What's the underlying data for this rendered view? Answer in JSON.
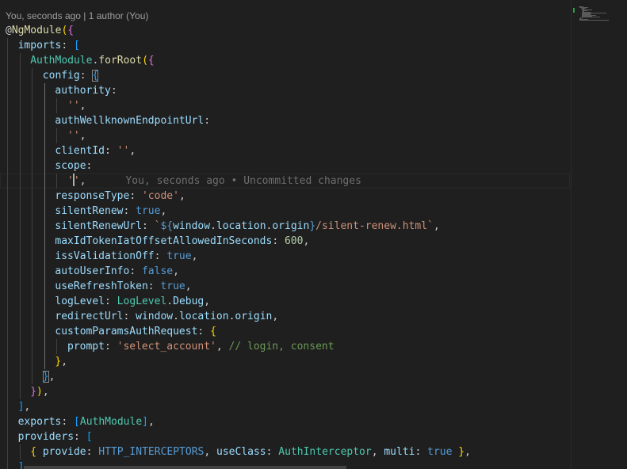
{
  "codelens": {
    "text": "You, seconds ago | 1 author (You)"
  },
  "blame": {
    "text": "You, seconds ago • Uncommitted changes"
  },
  "colors": {
    "background": "#1f1f1f",
    "property": "#9cdcfe",
    "string": "#ce9178",
    "number": "#b5cea8",
    "keyword": "#569cd6",
    "type": "#4ec9b0",
    "function": "#dcdcaa",
    "comment": "#6a9955",
    "bracket_level1": "#ffd700",
    "bracket_level2": "#da70d6",
    "bracket_level3": "#179fff",
    "git_added": "#2ea043"
  },
  "lines": [
    {
      "indent": 0,
      "tokens": [
        [
          "p",
          "@"
        ],
        [
          "f",
          "NgModule"
        ],
        [
          "br1",
          "("
        ],
        [
          "br2",
          "{"
        ]
      ]
    },
    {
      "indent": 1,
      "tokens": [
        [
          "k",
          "imports"
        ],
        [
          "p",
          ": "
        ],
        [
          "br3",
          "["
        ]
      ]
    },
    {
      "indent": 2,
      "tokens": [
        [
          "t",
          "AuthModule"
        ],
        [
          "p",
          "."
        ],
        [
          "f",
          "forRoot"
        ],
        [
          "br1",
          "("
        ],
        [
          "br2",
          "{"
        ]
      ]
    },
    {
      "indent": 3,
      "tokens": [
        [
          "k",
          "config"
        ],
        [
          "p",
          ": "
        ],
        [
          "br3",
          "{",
          true
        ]
      ]
    },
    {
      "indent": 4,
      "tokens": [
        [
          "k",
          "authority"
        ],
        [
          "p",
          ":"
        ]
      ]
    },
    {
      "indent": 5,
      "tokens": [
        [
          "s",
          "''"
        ],
        [
          "p",
          ","
        ]
      ]
    },
    {
      "indent": 4,
      "tokens": [
        [
          "k",
          "authWellknownEndpointUrl"
        ],
        [
          "p",
          ":"
        ]
      ]
    },
    {
      "indent": 5,
      "tokens": [
        [
          "s",
          "''"
        ],
        [
          "p",
          ","
        ]
      ]
    },
    {
      "indent": 4,
      "tokens": [
        [
          "k",
          "clientId"
        ],
        [
          "p",
          ": "
        ],
        [
          "s",
          "''"
        ],
        [
          "p",
          ","
        ]
      ]
    },
    {
      "indent": 4,
      "tokens": [
        [
          "k",
          "scope"
        ],
        [
          "p",
          ":"
        ]
      ]
    },
    {
      "indent": 5,
      "current": true,
      "tokens": [
        [
          "s",
          "'"
        ],
        [
          "caret",
          ""
        ],
        [
          "s",
          "'"
        ],
        [
          "p",
          ","
        ]
      ]
    },
    {
      "indent": 4,
      "tokens": [
        [
          "k",
          "responseType"
        ],
        [
          "p",
          ": "
        ],
        [
          "s",
          "'code'"
        ],
        [
          "p",
          ","
        ]
      ]
    },
    {
      "indent": 4,
      "tokens": [
        [
          "k",
          "silentRenew"
        ],
        [
          "p",
          ": "
        ],
        [
          "b",
          "true"
        ],
        [
          "p",
          ","
        ]
      ]
    },
    {
      "indent": 4,
      "tokens": [
        [
          "k",
          "silentRenewUrl"
        ],
        [
          "p",
          ": "
        ],
        [
          "s",
          "`"
        ],
        [
          "b",
          "${"
        ],
        [
          "k",
          "window"
        ],
        [
          "p",
          "."
        ],
        [
          "k",
          "location"
        ],
        [
          "p",
          "."
        ],
        [
          "k",
          "origin"
        ],
        [
          "b",
          "}"
        ],
        [
          "s",
          "/silent-renew.html`"
        ],
        [
          "p",
          ","
        ]
      ]
    },
    {
      "indent": 4,
      "tokens": [
        [
          "k",
          "maxIdTokenIatOffsetAllowedInSeconds"
        ],
        [
          "p",
          ": "
        ],
        [
          "n",
          "600"
        ],
        [
          "p",
          ","
        ]
      ]
    },
    {
      "indent": 4,
      "tokens": [
        [
          "k",
          "issValidationOff"
        ],
        [
          "p",
          ": "
        ],
        [
          "b",
          "true"
        ],
        [
          "p",
          ","
        ]
      ]
    },
    {
      "indent": 4,
      "tokens": [
        [
          "k",
          "autoUserInfo"
        ],
        [
          "p",
          ": "
        ],
        [
          "b",
          "false"
        ],
        [
          "p",
          ","
        ]
      ]
    },
    {
      "indent": 4,
      "tokens": [
        [
          "k",
          "useRefreshToken"
        ],
        [
          "p",
          ": "
        ],
        [
          "b",
          "true"
        ],
        [
          "p",
          ","
        ]
      ]
    },
    {
      "indent": 4,
      "tokens": [
        [
          "k",
          "logLevel"
        ],
        [
          "p",
          ": "
        ],
        [
          "t",
          "LogLevel"
        ],
        [
          "p",
          "."
        ],
        [
          "k",
          "Debug"
        ],
        [
          "p",
          ","
        ]
      ]
    },
    {
      "indent": 4,
      "tokens": [
        [
          "k",
          "redirectUrl"
        ],
        [
          "p",
          ": "
        ],
        [
          "k",
          "window"
        ],
        [
          "p",
          "."
        ],
        [
          "k",
          "location"
        ],
        [
          "p",
          "."
        ],
        [
          "k",
          "origin"
        ],
        [
          "p",
          ","
        ]
      ]
    },
    {
      "indent": 4,
      "tokens": [
        [
          "k",
          "customParamsAuthRequest"
        ],
        [
          "p",
          ": "
        ],
        [
          "br1",
          "{"
        ]
      ]
    },
    {
      "indent": 5,
      "tokens": [
        [
          "k",
          "prompt"
        ],
        [
          "p",
          ": "
        ],
        [
          "s",
          "'select_account'"
        ],
        [
          "p",
          ", "
        ],
        [
          "c",
          "// login, consent"
        ]
      ]
    },
    {
      "indent": 4,
      "tokens": [
        [
          "br1",
          "}"
        ],
        [
          "p",
          ","
        ]
      ]
    },
    {
      "indent": 3,
      "tokens": [
        [
          "br3",
          "}",
          true
        ],
        [
          "p",
          ","
        ]
      ]
    },
    {
      "indent": 2,
      "tokens": [
        [
          "br2",
          "}"
        ],
        [
          "br1",
          ")"
        ],
        [
          "p",
          ","
        ]
      ]
    },
    {
      "indent": 1,
      "tokens": [
        [
          "br3",
          "]"
        ],
        [
          "p",
          ","
        ]
      ]
    },
    {
      "indent": 1,
      "tokens": [
        [
          "k",
          "exports"
        ],
        [
          "p",
          ": "
        ],
        [
          "br3",
          "["
        ],
        [
          "t",
          "AuthModule"
        ],
        [
          "br3",
          "]"
        ],
        [
          "p",
          ","
        ]
      ]
    },
    {
      "indent": 1,
      "tokens": [
        [
          "k",
          "providers"
        ],
        [
          "p",
          ": "
        ],
        [
          "br3",
          "["
        ]
      ]
    },
    {
      "indent": 2,
      "tokens": [
        [
          "br1",
          "{"
        ],
        [
          "p",
          " "
        ],
        [
          "k",
          "provide"
        ],
        [
          "p",
          ": "
        ],
        [
          "b",
          "HTTP_INTERCEPTORS"
        ],
        [
          "p",
          ", "
        ],
        [
          "k",
          "useClass"
        ],
        [
          "p",
          ": "
        ],
        [
          "t",
          "AuthInterceptor"
        ],
        [
          "p",
          ", "
        ],
        [
          "k",
          "multi"
        ],
        [
          "p",
          ": "
        ],
        [
          "b",
          "true"
        ],
        [
          "p",
          " "
        ],
        [
          "br1",
          "}"
        ],
        [
          "p",
          ","
        ]
      ]
    },
    {
      "indent": 1,
      "tokens": [
        [
          "br3",
          "]"
        ]
      ]
    }
  ]
}
